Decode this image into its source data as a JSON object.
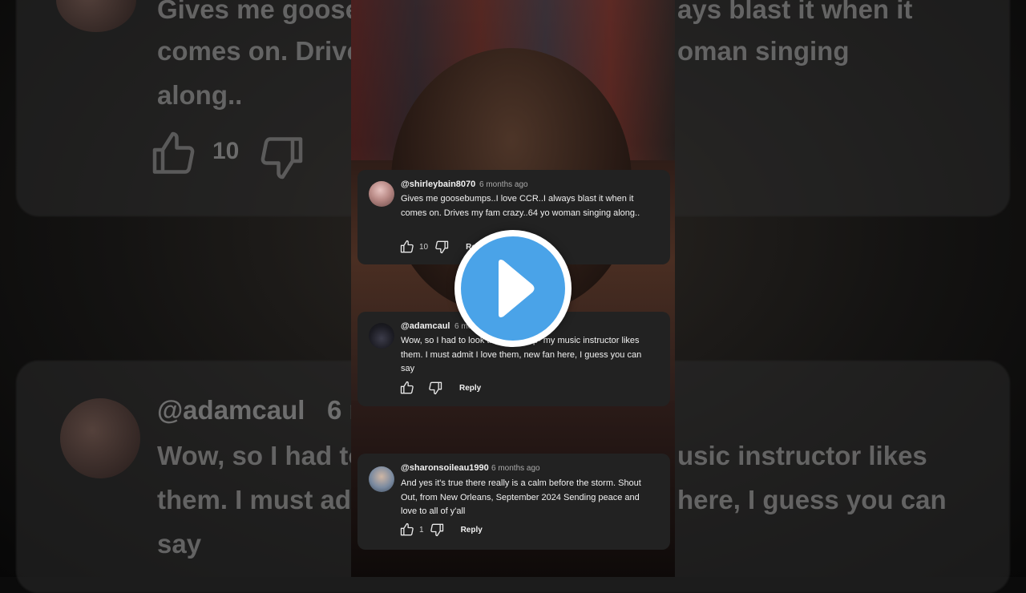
{
  "background": {
    "comment1": {
      "line1": "Gives me goose",
      "line1b": "ays blast it when it",
      "line2": "comes on. Drive",
      "line2b": "oman singing",
      "line3": "along..",
      "like_count": "10"
    },
    "comment2": {
      "handle": "@adamcaul",
      "time_fragment": "6 r",
      "line1": "Wow, so I had to",
      "line1b": "usic instructor likes",
      "line2": "them. I must ad",
      "line2b": "here, I guess you can",
      "line3": "say"
    }
  },
  "comments": [
    {
      "handle": "@shirleybain8070",
      "time": "6 months ago",
      "text": "Gives me goosebumps..I love CCR..I always blast it when it comes on. Drives my fam crazy..64 yo woman singing along..",
      "likes": "10",
      "reply_label": "Reply"
    },
    {
      "handle": "@adamcaul",
      "time": "6 months ago",
      "text": "Wow, so I had to look this group up- my music instructor likes them. I must admit I love them, new fan here, I guess you can say",
      "likes": "",
      "reply_label": "Reply"
    },
    {
      "handle": "@sharonsoileau1990",
      "time": "6 months ago",
      "text": "And yes it's true there really is a calm before the storm. Shout Out, from New Orleans, September 2024  Sending peace and love to all of y'all",
      "likes": "1",
      "reply_label": "Reply"
    }
  ],
  "icons": {
    "like": "thumbs-up-icon",
    "dislike": "thumbs-down-icon",
    "play": "play-icon"
  },
  "colors": {
    "card_bg": "#222222",
    "play_accent": "#4aa3e8"
  }
}
